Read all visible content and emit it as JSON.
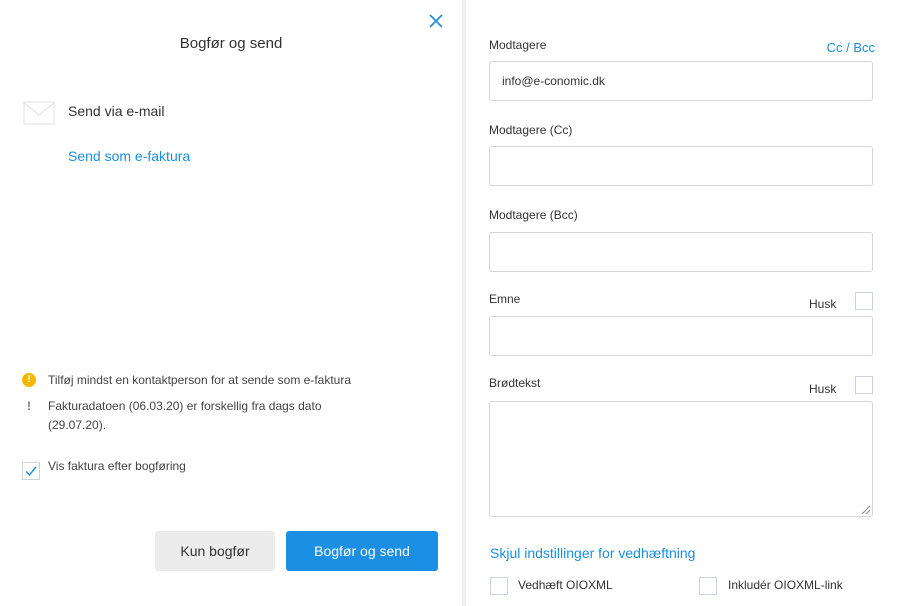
{
  "dialog": {
    "title": "Bogfør og send",
    "send_email": "Send via e-mail",
    "send_efaktura": "Send som e-faktura",
    "warnings": [
      {
        "icon": "!",
        "lines": [
          "Tilføj mindst en kontaktperson for at sende som e-faktura"
        ]
      },
      {
        "icon": "!",
        "lines": [
          "Fakturadatoen (06.03.20) er forskellig fra dags dato",
          "(29.07.20)."
        ]
      }
    ],
    "show_invoice_label": "Vis faktura efter bogføring",
    "show_invoice_checked": true,
    "only_post_label": "Kun bogfør",
    "post_send_label": "Bogfør og send",
    "accent_color": "#1a8fe3"
  },
  "email": {
    "recipients_label": "Modtagere",
    "cc_bcc_label": "Cc / Bcc",
    "recipients_value": "info@e-conomic.dk",
    "cc_label": "Modtagere (Cc)",
    "cc_value": "",
    "bcc_label": "Modtagere (Bcc)",
    "bcc_value": "",
    "subject_label": "Emne",
    "subject_value": "",
    "body_label": "Brødtekst",
    "remember_label": "Husk",
    "hide_attachment_settings": "Skjul indstillinger for vedhæftning",
    "attach_oioxml_label": "Vedhæft OIOXML",
    "include_oioxml_link_label": "Inkludér OIOXML-link"
  }
}
